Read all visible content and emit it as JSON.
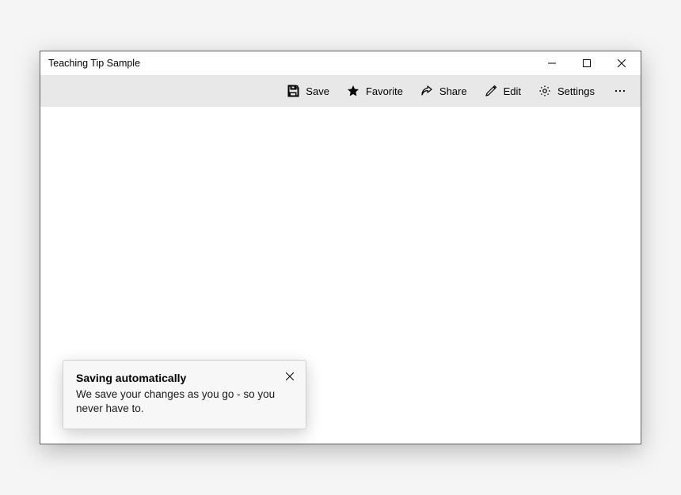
{
  "window": {
    "title": "Teaching Tip Sample"
  },
  "commandbar": {
    "save": "Save",
    "favorite": "Favorite",
    "share": "Share",
    "edit": "Edit",
    "settings": "Settings"
  },
  "teaching_tip": {
    "title": "Saving automatically",
    "subtitle": "We save your changes as you go - so you never have to."
  }
}
